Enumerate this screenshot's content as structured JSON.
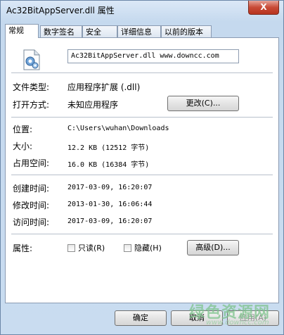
{
  "window": {
    "title": "Ac32BitAppServer.dll 属性",
    "close_glyph": "X"
  },
  "tabs": [
    {
      "label": "常规",
      "active": true
    },
    {
      "label": "数字签名",
      "active": false
    },
    {
      "label": "安全",
      "active": false
    },
    {
      "label": "详细信息",
      "active": false
    },
    {
      "label": "以前的版本",
      "active": false
    }
  ],
  "file": {
    "name": "Ac32BitAppServer.dll www.downcc.com"
  },
  "fields": {
    "type_label": "文件类型:",
    "type_value": "应用程序扩展 (.dll)",
    "open_label": "打开方式:",
    "open_value": "未知应用程序",
    "change_button": "更改(C)...",
    "location_label": "位置:",
    "location_value": "C:\\Users\\wuhan\\Downloads",
    "size_label": "大小:",
    "size_value": "12.2 KB (12512 字节)",
    "disk_label": "占用空间:",
    "disk_value": "16.0 KB (16384 字节)",
    "created_label": "创建时间:",
    "created_value": "2017-03-09, 16:20:07",
    "modified_label": "修改时间:",
    "modified_value": "2013-01-30, 16:06:44",
    "accessed_label": "访问时间:",
    "accessed_value": "2017-03-09, 16:20:07",
    "attrs_label": "属性:",
    "readonly_label": "只读(R)",
    "hidden_label": "隐藏(H)",
    "advanced_button": "高级(D)..."
  },
  "footer": {
    "ok": "确定",
    "cancel": "取消",
    "apply": "应用(A)"
  },
  "watermark": {
    "main": "绿色资源网",
    "sub": "www.downcc.com"
  },
  "colors": {
    "close_button": "#c84a36",
    "watermark": "#7ec38c"
  }
}
